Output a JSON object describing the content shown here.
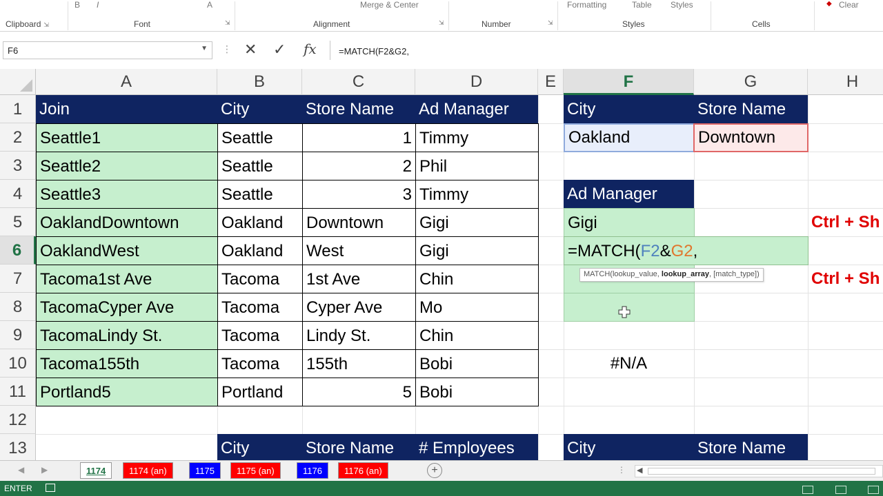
{
  "ribbon": {
    "groups": [
      "Clipboard",
      "Font",
      "Alignment",
      "Number",
      "Styles",
      "Cells"
    ],
    "top_fragments": {
      "merge": "Merge & Center",
      "formatting": "Formatting",
      "table": "Table",
      "styles": "Styles",
      "clear": "Clear"
    }
  },
  "formula_bar": {
    "name_box": "F6",
    "formula": "=MATCH(F2&G2,",
    "fx": "fx"
  },
  "columns": [
    "A",
    "B",
    "C",
    "D",
    "E",
    "F",
    "G",
    "H"
  ],
  "selected_column": "F",
  "rows": [
    "1",
    "2",
    "3",
    "4",
    "5",
    "6",
    "7",
    "8",
    "9",
    "10",
    "11",
    "12",
    "13"
  ],
  "selected_row": "6",
  "table": {
    "headers": [
      "Join",
      "City",
      "Store Name",
      "Ad Manager"
    ],
    "rows": [
      [
        "Seattle1",
        "Seattle",
        "1",
        "Timmy"
      ],
      [
        "Seattle2",
        "Seattle",
        "2",
        "Phil"
      ],
      [
        "Seattle3",
        "Seattle",
        "3",
        "Timmy"
      ],
      [
        "OaklandDowntown",
        "Oakland",
        "Downtown",
        "Gigi"
      ],
      [
        "OaklandWest",
        "Oakland",
        "West",
        "Gigi"
      ],
      [
        "Tacoma1st Ave",
        "Tacoma",
        "1st Ave",
        "Chin"
      ],
      [
        "TacomaCyper Ave",
        "Tacoma",
        "Cyper Ave",
        "Mo"
      ],
      [
        "TacomaLindy St.",
        "Tacoma",
        "Lindy St.",
        "Chin"
      ],
      [
        "Tacoma155th",
        "Tacoma",
        "155th",
        "Bobi"
      ],
      [
        "Portland5",
        "Portland",
        "5",
        "Bobi"
      ]
    ]
  },
  "lookup": {
    "city_header": "City",
    "store_header": "Store Name",
    "city_value": "Oakland",
    "store_value": "Downtown",
    "ad_manager_header": "Ad Manager",
    "ad_manager_value": "Gigi",
    "edit": {
      "prefix": "=MATCH(",
      "ref1": "F2",
      "amp": "&",
      "ref2": "G2",
      "suffix": ","
    },
    "na_value": "#N/A"
  },
  "tooltip": {
    "fn": "MATCH(",
    "arg1": "lookup_value, ",
    "arg2": "lookup_array",
    "arg3": ", [match_type])"
  },
  "row13_headers": {
    "b": "City",
    "c": "Store Name",
    "d": "# Employees",
    "f": "City",
    "g": "Store Name"
  },
  "notes": {
    "n1": "Ctrl + Sh",
    "n2": "Ctrl + Sh"
  },
  "sheet_tabs": [
    {
      "label": "1174",
      "active": true,
      "color": "#ffffff"
    },
    {
      "label": "1174 (an)",
      "active": false,
      "color": "#ff0000"
    },
    {
      "label": "1175",
      "active": false,
      "color": "#0000ff"
    },
    {
      "label": "1175 (an)",
      "active": false,
      "color": "#ff0000"
    },
    {
      "label": "1176",
      "active": false,
      "color": "#0000ff"
    },
    {
      "label": "1176 (an)",
      "active": false,
      "color": "#ff0000"
    }
  ],
  "add_sheet": "+",
  "status": {
    "mode": "ENTER"
  },
  "colors": {
    "header_fill": "#0f2461",
    "green_fill": "#c6efce",
    "excel_green": "#217346",
    "note_red": "#e00000"
  }
}
